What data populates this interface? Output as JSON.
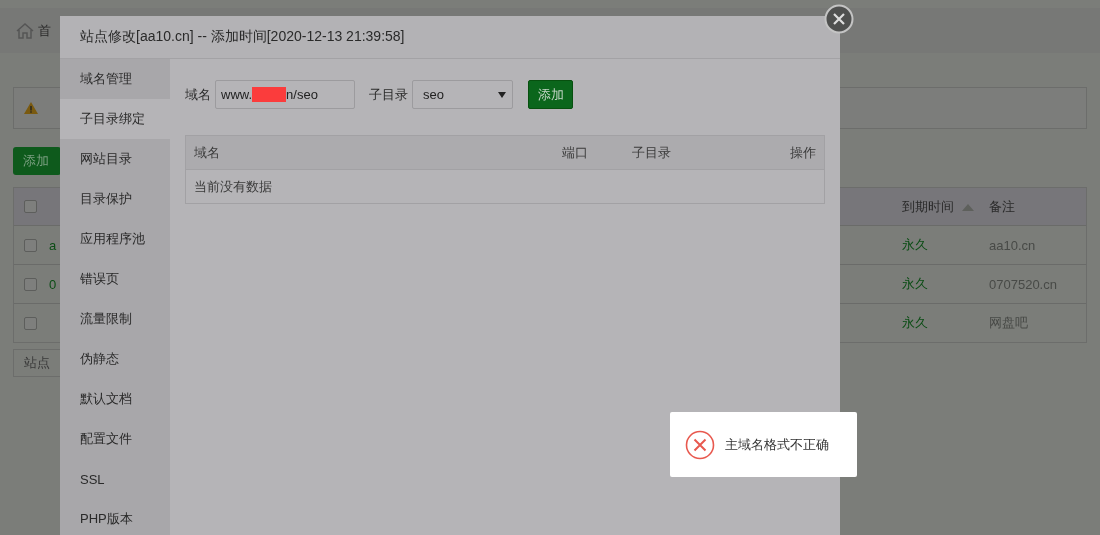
{
  "background": {
    "breadcrumb": "首",
    "add_button": "添加",
    "footer": "站点",
    "table": {
      "all_checked": false,
      "columns": [
        {
          "label": "到期时间",
          "sorted": true
        },
        {
          "label": "备注",
          "sorted": false
        }
      ],
      "rows": [
        {
          "name": "a",
          "expiry": "永久",
          "note": "aa10.cn",
          "checked": false
        },
        {
          "name": "0",
          "expiry": "永久",
          "note": "0707520.cn",
          "checked": false
        },
        {
          "expiry": "永久",
          "note": "网盘吧",
          "checked": false
        }
      ]
    }
  },
  "modal": {
    "title": "站点修改[aa10.cn] -- 添加时间[2020-12-13 21:39:58]",
    "tabs": [
      {
        "label": "域名管理",
        "selected": false
      },
      {
        "label": "子目录绑定",
        "selected": true
      },
      {
        "label": "网站目录",
        "selected": false
      },
      {
        "label": "目录保护",
        "selected": false
      },
      {
        "label": "应用程序池",
        "selected": false
      },
      {
        "label": "错误页",
        "selected": false
      },
      {
        "label": "流量限制",
        "selected": false
      },
      {
        "label": "伪静态",
        "selected": false
      },
      {
        "label": "默认文档",
        "selected": false
      },
      {
        "label": "配置文件",
        "selected": false
      },
      {
        "label": "SSL",
        "selected": false
      },
      {
        "label": "PHP版本",
        "selected": false
      }
    ],
    "form": {
      "domain_label": "域名",
      "domain_value_start": "www.",
      "domain_redacted": true,
      "domain_value_end": "n/seo",
      "subdir_label": "子目录",
      "subdir_value": "seo",
      "add_button": "添加"
    },
    "table": {
      "columns": [
        "域名",
        "端口",
        "子目录",
        "操作"
      ],
      "empty_text": "当前没有数据"
    }
  },
  "toast": {
    "kind": "error",
    "message": "主域名格式不正确"
  }
}
